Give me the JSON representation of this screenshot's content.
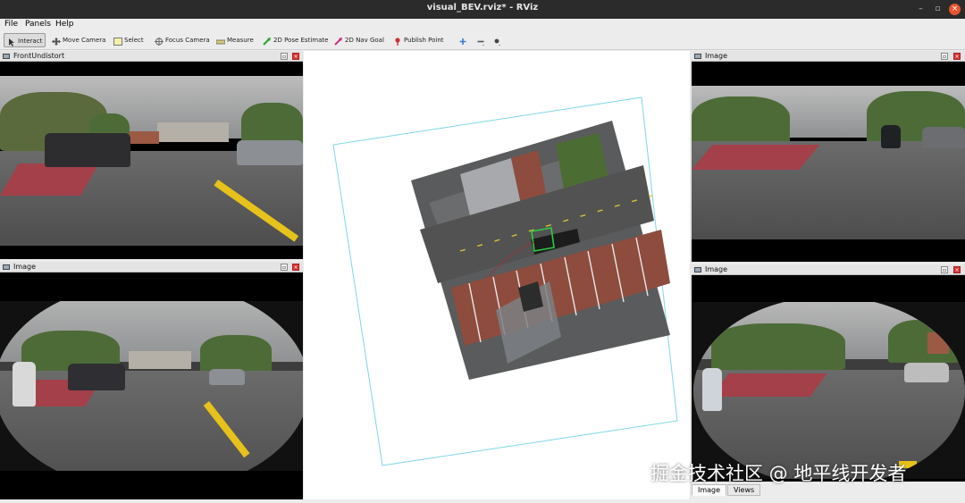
{
  "window": {
    "title": "visual_BEV.rviz* - RViz",
    "min": "–",
    "max": "▫",
    "close": "×"
  },
  "menu": {
    "file": "File",
    "panels": "Panels",
    "help": "Help"
  },
  "toolbar": {
    "interact": "Interact",
    "move_camera": "Move Camera",
    "select": "Select",
    "focus_camera": "Focus Camera",
    "measure": "Measure",
    "pose_estimate": "2D Pose Estimate",
    "nav_goal": "2D Nav Goal",
    "publish_point": "Publish Point"
  },
  "panels": {
    "front": {
      "title": "FrontUndistort"
    },
    "left_bottom": {
      "title": "Image"
    },
    "right_top": {
      "title": "Image"
    },
    "right_bottom": {
      "title": "Image"
    }
  },
  "tabs": {
    "image": "Image",
    "views": "Views"
  },
  "watermark": "掘金技术社区 @ 地平线开发者",
  "colors": {
    "titlebar": "#2b2b2b",
    "close": "#e8542e",
    "bev_frame": "#7fd6e6",
    "lane_red": "#a3404a",
    "lane_yellow": "#e6c21b"
  }
}
